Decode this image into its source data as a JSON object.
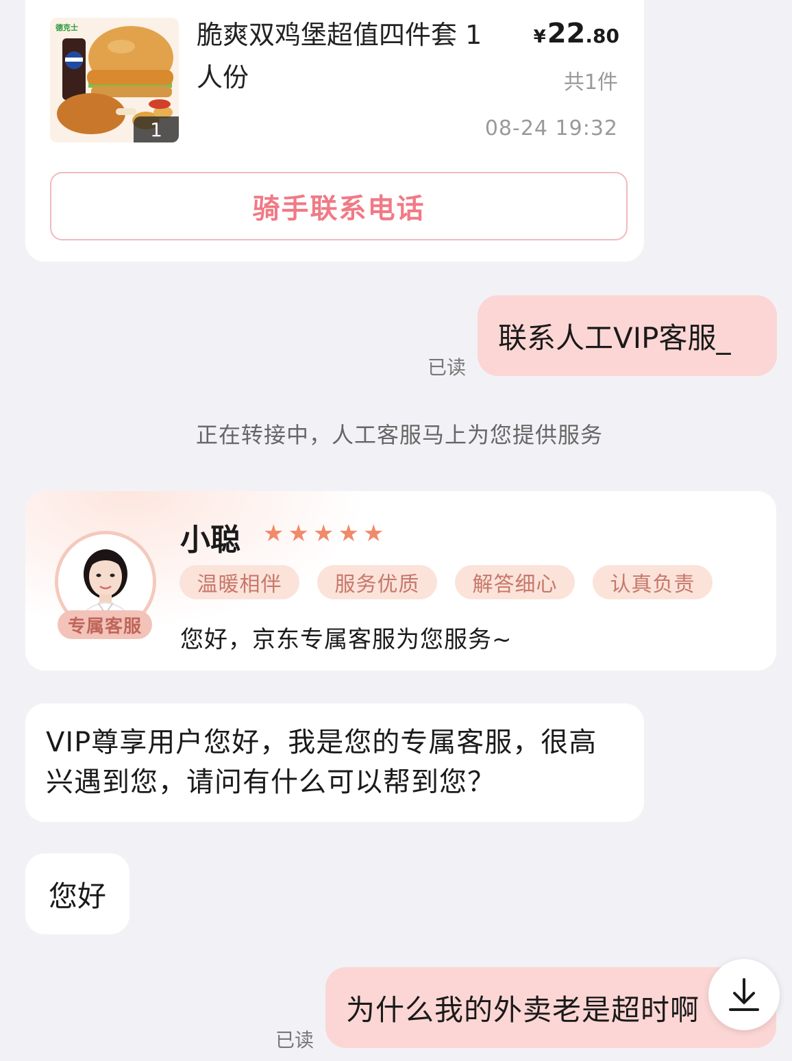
{
  "order": {
    "brand": "德克士",
    "product_name": "脆爽双鸡堡超值四件套 1人份",
    "quantity_badge": "1",
    "price_symbol": "¥",
    "price_integer": "22",
    "price_decimal": ".80",
    "count": "共1件",
    "time": "08-24 19:32",
    "rider_button": "骑手联系电话"
  },
  "messages": {
    "user_msg_1": "联系人工VIP客服_",
    "read_1": "已读",
    "system_msg": "正在转接中，人工客服马上为您提供服务",
    "agent_vip_msg": "VIP尊享用户您好，我是您的专属客服，很高兴遇到您，请问有什么可以帮到您？",
    "agent_hello": "您好",
    "user_msg_2": "为什么我的外卖老是超时啊",
    "read_2": "已读"
  },
  "agent": {
    "name": "小聪",
    "rating": 5,
    "badge": "专属客服",
    "tags": [
      "温暖相伴",
      "服务优质",
      "解答细心",
      "认真负责"
    ],
    "greeting": "您好，京东专属客服为您服务~"
  },
  "colors": {
    "user_bubble": "#fbd6d4",
    "accent_pink": "#f07a85",
    "star": "#f08a6a",
    "tag_bg": "#fbe3da"
  },
  "icons": {
    "download": "download-arrow-icon",
    "star": "star-icon"
  }
}
